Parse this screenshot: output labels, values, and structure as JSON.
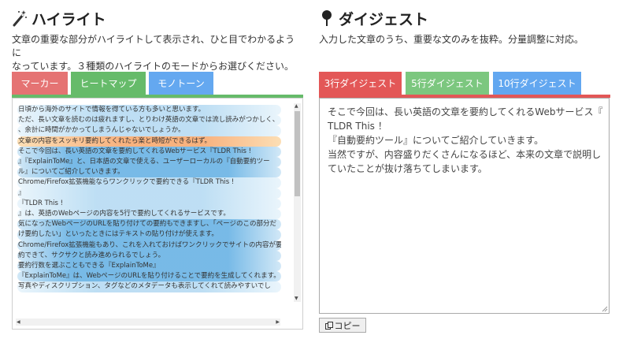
{
  "left": {
    "title": "ハイライト",
    "title_icon": "magic-wand-icon",
    "desc": [
      "文章の重要な部分がハイライトして表示され、ひと目でわかるように",
      "なっています。３種類のハイライトのモードからお選びください。"
    ],
    "tabs": [
      {
        "label": "マーカー",
        "color": "#e57373"
      },
      {
        "label": "ヒートマップ",
        "color": "#66bb6a"
      },
      {
        "label": "モノトーン",
        "color": "#64a8f0"
      }
    ],
    "active_tab": "ヒートマップ",
    "lines": [
      {
        "text": "日頃から海外のサイトで情報を得ている方も多いと思います。",
        "heat": "blue-light"
      },
      {
        "text": "ただ、長い文章を読むのは疲れますし、とりわけ英語の文章では流し読みがつかしく、",
        "heat": "blue-light"
      },
      {
        "text": "、余計に時間がかかってしまうんじゃないでしょうか。",
        "heat": "blue-light"
      },
      {
        "text": "文章の内容をスッキリ要約してくれたら楽と時短ができるはず。",
        "heat": "orange"
      },
      {
        "text": "そこで今回は、長い英語の文章を要約してくれるWebサービス『TLDR This !",
        "heat": "blue"
      },
      {
        "text": "』『ExplainToMe』と、日本語の文章で使える、ユーザーローカルの『自動要約ツー",
        "heat": "blue"
      },
      {
        "text": "ル』についてご紹介していきます。",
        "heat": "blue"
      },
      {
        "text": "Chrome/Firefox拡張機能ならワンクリックで要約できる『TLDR This !",
        "heat": "blue-light"
      },
      {
        "text": "』",
        "heat": "blue-light"
      },
      {
        "text": "『TLDR This !",
        "heat": "blue-light"
      },
      {
        "text": "』は、英語のWebページの内容を5行で要約してくれるサービスです。",
        "heat": "blue-light"
      },
      {
        "text": "気になったWebページのURLを貼り付けての要約もできますし、「ページのこの部分だ",
        "heat": "blue"
      },
      {
        "text": "け要約したい」といったときにはテキストの貼り付けが使えます。",
        "heat": "blue"
      },
      {
        "text": "Chrome/Firefox拡張機能もあり、これを入れておけばワンクリックでサイトの内容が要",
        "heat": "blue"
      },
      {
        "text": "約できて、サクサクと読み進められるでしょう。",
        "heat": "blue"
      },
      {
        "text": "要約行数を選ぶこともできる『ExplainToMe』",
        "heat": "blue"
      },
      {
        "text": "『ExplainToMe』は、WebページのURLを貼り付けることで要約を生成してくれます。",
        "heat": "blue"
      },
      {
        "text": "写真やディスクリプション、タグなどのメタデータも表示してくれて読みやすいでし",
        "heat": "blue-light"
      }
    ]
  },
  "right": {
    "title": "ダイジェスト",
    "title_icon": "map-pin-icon",
    "desc": "入力した文章のうち、重要な文のみを抜粋。分量調整に対応。",
    "tabs": [
      {
        "label": "3行ダイジェスト",
        "color": "#e35757"
      },
      {
        "label": "5行ダイジェスト",
        "color": "#7cc77f"
      },
      {
        "label": "10行ダイジェスト",
        "color": "#62a7f0"
      }
    ],
    "active_tab": "3行ダイジェスト",
    "output": [
      "そこで今回は、長い英語の文章を要約してくれるWebサービス『",
      "TLDR This ！",
      "『自動要約ツール』についてご紹介していきます。",
      "当然ですが、内容盛りだくさんになるほど、本来の文章で説明し",
      "ていたことが抜け落ちてしまいます。"
    ],
    "copy_label": "コピー",
    "copy_icon": "copy-icon"
  }
}
